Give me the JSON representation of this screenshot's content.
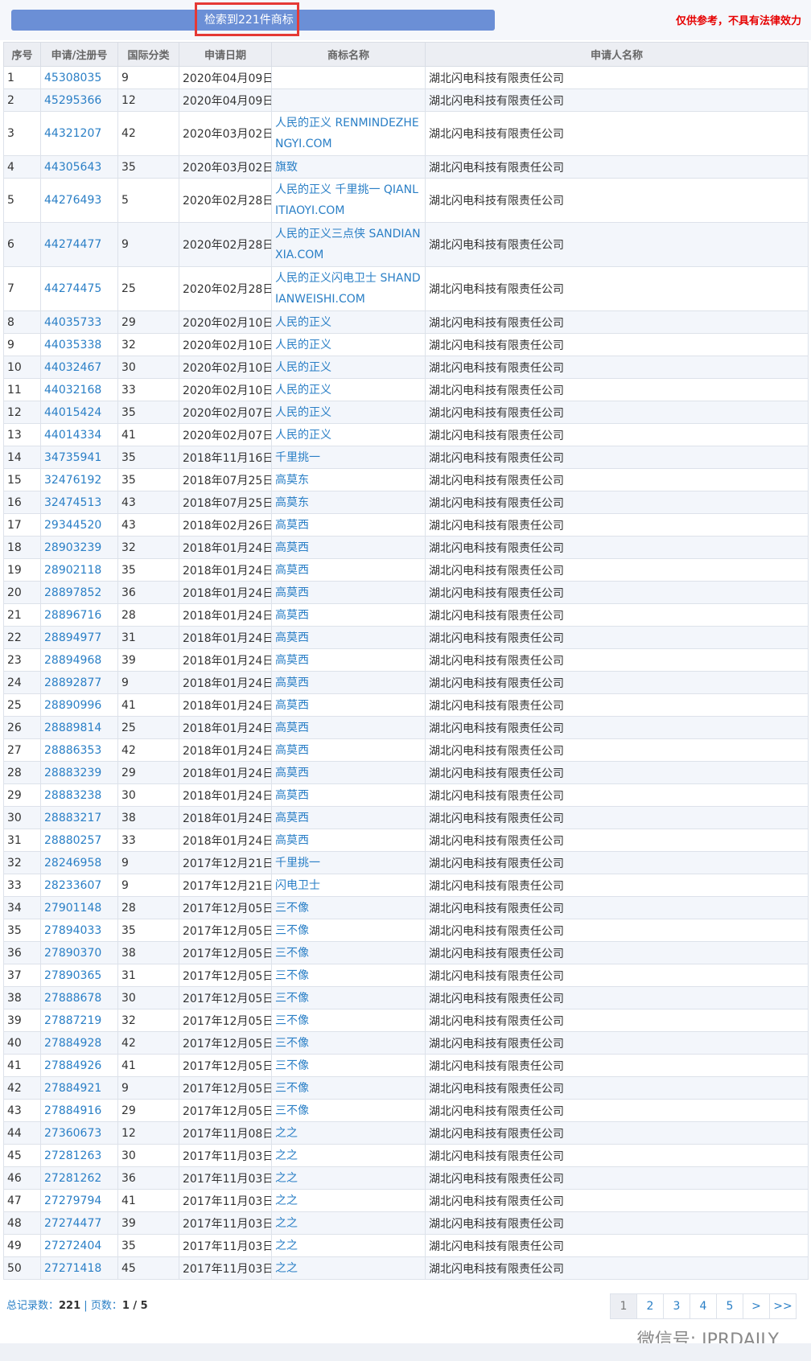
{
  "header": {
    "result_text": "检索到221件商标",
    "disclaimer": "仅供参考，不具有法律效力"
  },
  "table": {
    "columns": [
      "序号",
      "申请/注册号",
      "国际分类",
      "申请日期",
      "商标名称",
      "申请人名称"
    ],
    "rows": [
      [
        "1",
        "45308035",
        "9",
        "2020年04月09日",
        "",
        "湖北闪电科技有限责任公司"
      ],
      [
        "2",
        "45295366",
        "12",
        "2020年04月09日",
        "",
        "湖北闪电科技有限责任公司"
      ],
      [
        "3",
        "44321207",
        "42",
        "2020年03月02日",
        "人民的正义 RENMINDEZHENGYI.COM",
        "湖北闪电科技有限责任公司"
      ],
      [
        "4",
        "44305643",
        "35",
        "2020年03月02日",
        "旗致",
        "湖北闪电科技有限责任公司"
      ],
      [
        "5",
        "44276493",
        "5",
        "2020年02月28日",
        "人民的正义 千里挑一 QIANLITIAOYI.COM",
        "湖北闪电科技有限责任公司"
      ],
      [
        "6",
        "44274477",
        "9",
        "2020年02月28日",
        "人民的正义三点侠 SANDIANXIA.COM",
        "湖北闪电科技有限责任公司"
      ],
      [
        "7",
        "44274475",
        "25",
        "2020年02月28日",
        "人民的正义闪电卫士 SHANDIANWEISHI.COM",
        "湖北闪电科技有限责任公司"
      ],
      [
        "8",
        "44035733",
        "29",
        "2020年02月10日",
        "人民的正义",
        "湖北闪电科技有限责任公司"
      ],
      [
        "9",
        "44035338",
        "32",
        "2020年02月10日",
        "人民的正义",
        "湖北闪电科技有限责任公司"
      ],
      [
        "10",
        "44032467",
        "30",
        "2020年02月10日",
        "人民的正义",
        "湖北闪电科技有限责任公司"
      ],
      [
        "11",
        "44032168",
        "33",
        "2020年02月10日",
        "人民的正义",
        "湖北闪电科技有限责任公司"
      ],
      [
        "12",
        "44015424",
        "35",
        "2020年02月07日",
        "人民的正义",
        "湖北闪电科技有限责任公司"
      ],
      [
        "13",
        "44014334",
        "41",
        "2020年02月07日",
        "人民的正义",
        "湖北闪电科技有限责任公司"
      ],
      [
        "14",
        "34735941",
        "35",
        "2018年11月16日",
        "千里挑一",
        "湖北闪电科技有限责任公司"
      ],
      [
        "15",
        "32476192",
        "35",
        "2018年07月25日",
        "高莫东",
        "湖北闪电科技有限责任公司"
      ],
      [
        "16",
        "32474513",
        "43",
        "2018年07月25日",
        "高莫东",
        "湖北闪电科技有限责任公司"
      ],
      [
        "17",
        "29344520",
        "43",
        "2018年02月26日",
        "高莫西",
        "湖北闪电科技有限责任公司"
      ],
      [
        "18",
        "28903239",
        "32",
        "2018年01月24日",
        "高莫西",
        "湖北闪电科技有限责任公司"
      ],
      [
        "19",
        "28902118",
        "35",
        "2018年01月24日",
        "高莫西",
        "湖北闪电科技有限责任公司"
      ],
      [
        "20",
        "28897852",
        "36",
        "2018年01月24日",
        "高莫西",
        "湖北闪电科技有限责任公司"
      ],
      [
        "21",
        "28896716",
        "28",
        "2018年01月24日",
        "高莫西",
        "湖北闪电科技有限责任公司"
      ],
      [
        "22",
        "28894977",
        "31",
        "2018年01月24日",
        "高莫西",
        "湖北闪电科技有限责任公司"
      ],
      [
        "23",
        "28894968",
        "39",
        "2018年01月24日",
        "高莫西",
        "湖北闪电科技有限责任公司"
      ],
      [
        "24",
        "28892877",
        "9",
        "2018年01月24日",
        "高莫西",
        "湖北闪电科技有限责任公司"
      ],
      [
        "25",
        "28890996",
        "41",
        "2018年01月24日",
        "高莫西",
        "湖北闪电科技有限责任公司"
      ],
      [
        "26",
        "28889814",
        "25",
        "2018年01月24日",
        "高莫西",
        "湖北闪电科技有限责任公司"
      ],
      [
        "27",
        "28886353",
        "42",
        "2018年01月24日",
        "高莫西",
        "湖北闪电科技有限责任公司"
      ],
      [
        "28",
        "28883239",
        "29",
        "2018年01月24日",
        "高莫西",
        "湖北闪电科技有限责任公司"
      ],
      [
        "29",
        "28883238",
        "30",
        "2018年01月24日",
        "高莫西",
        "湖北闪电科技有限责任公司"
      ],
      [
        "30",
        "28883217",
        "38",
        "2018年01月24日",
        "高莫西",
        "湖北闪电科技有限责任公司"
      ],
      [
        "31",
        "28880257",
        "33",
        "2018年01月24日",
        "高莫西",
        "湖北闪电科技有限责任公司"
      ],
      [
        "32",
        "28246958",
        "9",
        "2017年12月21日",
        "千里挑一",
        "湖北闪电科技有限责任公司"
      ],
      [
        "33",
        "28233607",
        "9",
        "2017年12月21日",
        "闪电卫士",
        "湖北闪电科技有限责任公司"
      ],
      [
        "34",
        "27901148",
        "28",
        "2017年12月05日",
        "三不像",
        "湖北闪电科技有限责任公司"
      ],
      [
        "35",
        "27894033",
        "35",
        "2017年12月05日",
        "三不像",
        "湖北闪电科技有限责任公司"
      ],
      [
        "36",
        "27890370",
        "38",
        "2017年12月05日",
        "三不像",
        "湖北闪电科技有限责任公司"
      ],
      [
        "37",
        "27890365",
        "31",
        "2017年12月05日",
        "三不像",
        "湖北闪电科技有限责任公司"
      ],
      [
        "38",
        "27888678",
        "30",
        "2017年12月05日",
        "三不像",
        "湖北闪电科技有限责任公司"
      ],
      [
        "39",
        "27887219",
        "32",
        "2017年12月05日",
        "三不像",
        "湖北闪电科技有限责任公司"
      ],
      [
        "40",
        "27884928",
        "42",
        "2017年12月05日",
        "三不像",
        "湖北闪电科技有限责任公司"
      ],
      [
        "41",
        "27884926",
        "41",
        "2017年12月05日",
        "三不像",
        "湖北闪电科技有限责任公司"
      ],
      [
        "42",
        "27884921",
        "9",
        "2017年12月05日",
        "三不像",
        "湖北闪电科技有限责任公司"
      ],
      [
        "43",
        "27884916",
        "29",
        "2017年12月05日",
        "三不像",
        "湖北闪电科技有限责任公司"
      ],
      [
        "44",
        "27360673",
        "12",
        "2017年11月08日",
        "之之",
        "湖北闪电科技有限责任公司"
      ],
      [
        "45",
        "27281263",
        "30",
        "2017年11月03日",
        "之之",
        "湖北闪电科技有限责任公司"
      ],
      [
        "46",
        "27281262",
        "36",
        "2017年11月03日",
        "之之",
        "湖北闪电科技有限责任公司"
      ],
      [
        "47",
        "27279794",
        "41",
        "2017年11月03日",
        "之之",
        "湖北闪电科技有限责任公司"
      ],
      [
        "48",
        "27274477",
        "39",
        "2017年11月03日",
        "之之",
        "湖北闪电科技有限责任公司"
      ],
      [
        "49",
        "27272404",
        "35",
        "2017年11月03日",
        "之之",
        "湖北闪电科技有限责任公司"
      ],
      [
        "50",
        "27271418",
        "45",
        "2017年11月03日",
        "之之",
        "湖北闪电科技有限责任公司"
      ]
    ]
  },
  "footer": {
    "total_label": "总记录数：",
    "total_value": "221",
    "separator": " | ",
    "pages_label": "页数：",
    "pages_value": "1 / 5"
  },
  "pager": [
    "1",
    "2",
    "3",
    "4",
    "5",
    ">",
    ">>"
  ],
  "watermark": "微信号: IPRDAILY",
  "colors": {
    "banner": "#6b8fd6",
    "link": "#2a7fc6",
    "disclaimer": "#e60000",
    "highlight": "#e53935"
  }
}
